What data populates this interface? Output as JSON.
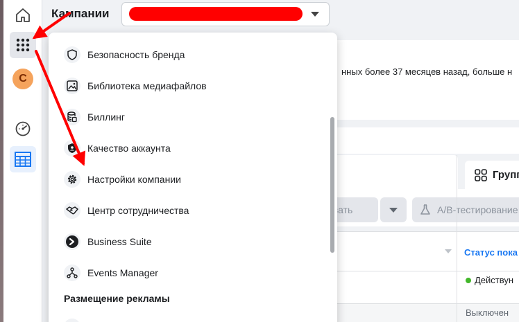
{
  "nav": {
    "avatar_letter": "C",
    "items": [
      "home-icon",
      "apps-grid-icon",
      "avatar",
      "gauge-icon",
      "table-icon"
    ]
  },
  "header": {
    "title": "Кампании"
  },
  "notice": {
    "text": "нных более 37 месяцев назад, больше н"
  },
  "tabs": {
    "groups_label": "Групп"
  },
  "toolbar": {
    "edit_label": "овать",
    "ab_test_label": "A/B-тестирование"
  },
  "table": {
    "status_header": "Статус пока",
    "rows": [
      {
        "status": "Действун"
      },
      {
        "status": "Выключен"
      }
    ]
  },
  "menu": {
    "items": [
      {
        "label": "Безопасность бренда",
        "icon": "shield-icon"
      },
      {
        "label": "Библиотека медиафайлов",
        "icon": "media-library-icon"
      },
      {
        "label": "Биллинг",
        "icon": "billing-icon"
      },
      {
        "label": "Качество аккаунта",
        "icon": "account-quality-icon"
      },
      {
        "label": "Настройки компании",
        "icon": "gear-icon"
      },
      {
        "label": "Центр сотрудничества",
        "icon": "handshake-icon"
      },
      {
        "label": "Business Suite",
        "icon": "business-suite-icon"
      },
      {
        "label": "Events Manager",
        "icon": "events-manager-icon"
      }
    ],
    "section_label": "Размещение рекламы"
  },
  "colors": {
    "accent": "#1877f2",
    "annotation": "#ff0000",
    "status_active": "#42b72a"
  }
}
